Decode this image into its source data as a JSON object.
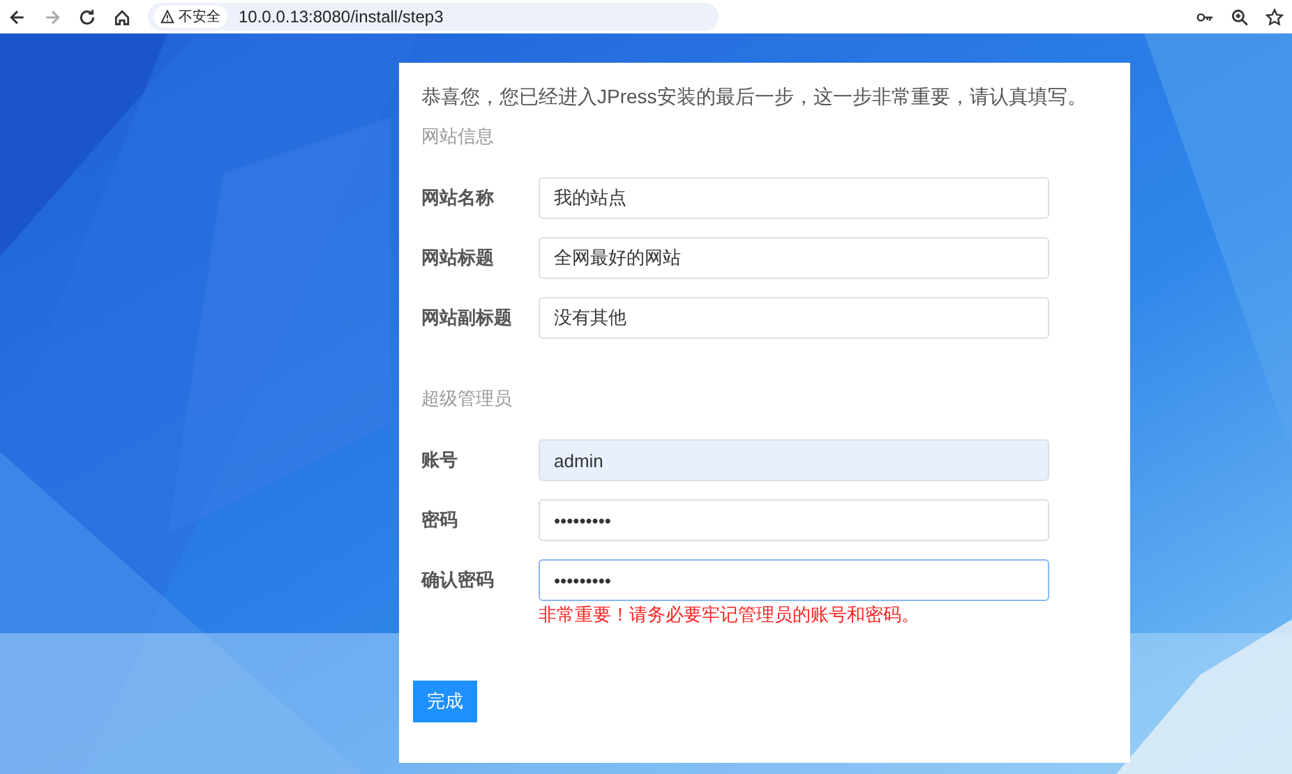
{
  "browser": {
    "security_label": "不安全",
    "url": "10.0.0.13:8080/install/step3"
  },
  "intro": "恭喜您，您已经进入JPress安装的最后一步，这一步非常重要，请认真填写。",
  "sections": [
    {
      "title": "网站信息",
      "fields": [
        {
          "label": "网站名称",
          "value": "我的站点",
          "autofilled": false,
          "focused": false
        },
        {
          "label": "网站标题",
          "value": "全网最好的网站",
          "autofilled": false,
          "focused": false
        },
        {
          "label": "网站副标题",
          "value": "没有其他",
          "autofilled": false,
          "focused": false
        }
      ]
    },
    {
      "title": "超级管理员",
      "fields": [
        {
          "label": "账号",
          "value": "admin",
          "autofilled": true,
          "focused": false
        },
        {
          "label": "密码",
          "value": "•••••••••",
          "autofilled": false,
          "focused": false
        },
        {
          "label": "确认密码",
          "value": "•••••••••",
          "autofilled": false,
          "focused": true
        }
      ],
      "warning": "非常重要！请务必要牢记管理员的账号和密码。"
    }
  ],
  "submit": "完成"
}
